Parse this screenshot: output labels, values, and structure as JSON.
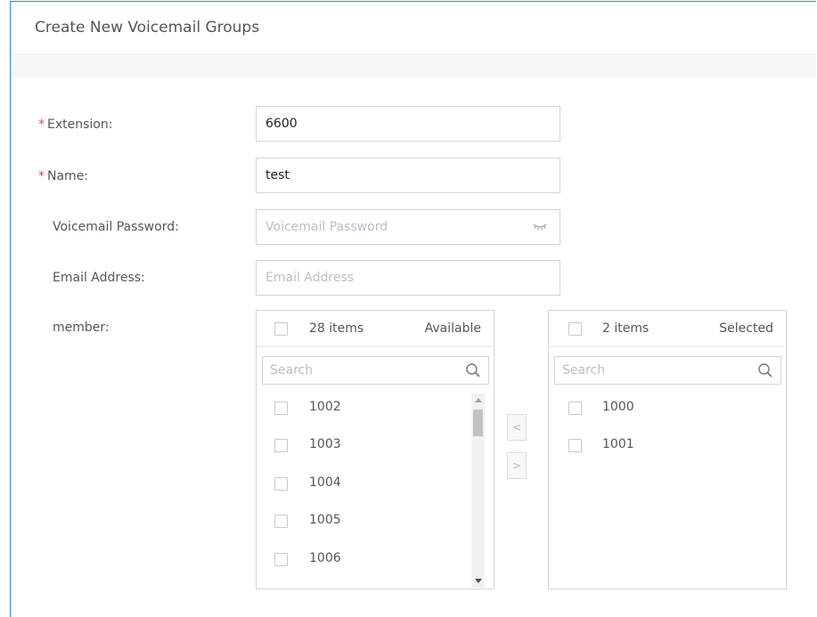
{
  "header": {
    "title": "Create New Voicemail Groups"
  },
  "form": {
    "extension_label": "Extension:",
    "extension_value": "6600",
    "name_label": "Name:",
    "name_value": "test",
    "password_label": "Voicemail Password:",
    "password_placeholder": "Voicemail Password",
    "email_label": "Email Address:",
    "email_placeholder": "Email Address",
    "member_label": "member:",
    "required_mark": "*"
  },
  "available": {
    "count": "28 items",
    "title": "Available",
    "search_placeholder": "Search",
    "items": [
      "1002",
      "1003",
      "1004",
      "1005",
      "1006"
    ]
  },
  "selected": {
    "count": "2 items",
    "title": "Selected",
    "search_placeholder": "Search",
    "items": [
      "1000",
      "1001"
    ]
  },
  "transfer": {
    "left_label": "<",
    "right_label": ">"
  },
  "icons": {
    "password_toggle": "eye-closed-icon",
    "search": "search-icon"
  },
  "colors": {
    "required": "#e8453c",
    "frame_border": "#3b86d6"
  }
}
